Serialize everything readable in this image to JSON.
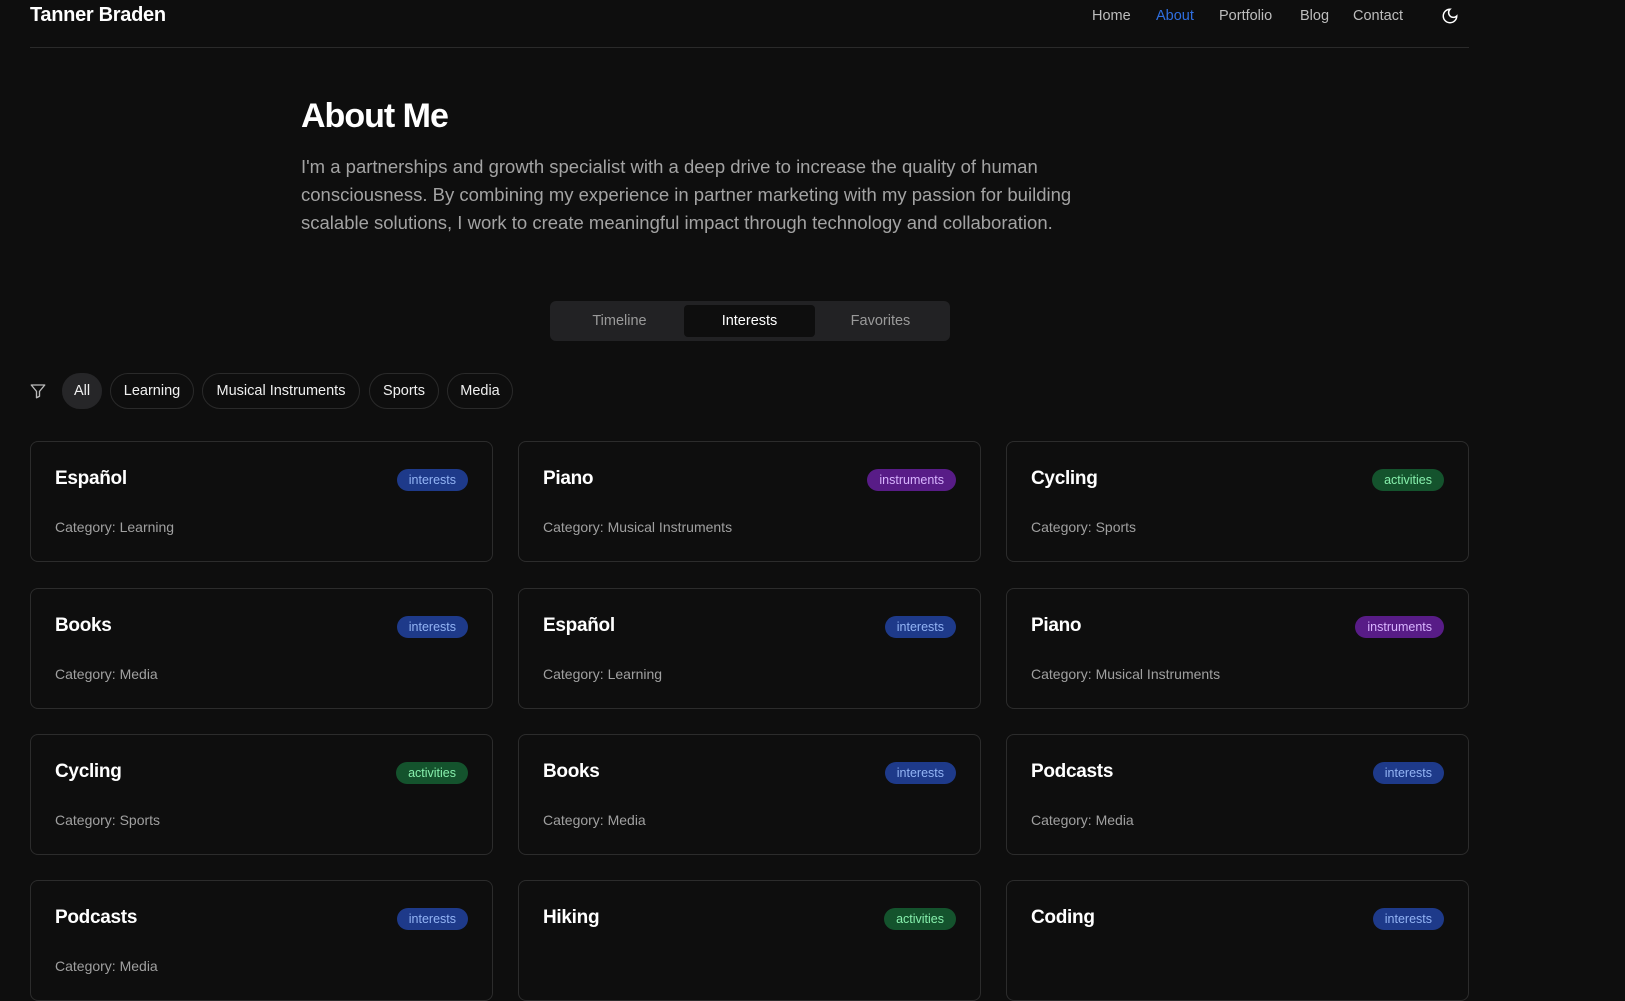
{
  "header": {
    "brand": "Tanner Braden",
    "nav": [
      {
        "label": "Home"
      },
      {
        "label": "About",
        "active": true
      },
      {
        "label": "Portfolio"
      },
      {
        "label": "Blog"
      },
      {
        "label": "Contact"
      }
    ],
    "theme_icon": "moon-icon"
  },
  "about": {
    "title": "About Me",
    "lines": [
      "I'm a partnerships and growth specialist with a deep drive to increase the quality of human",
      "consciousness. By combining my experience in partner marketing with my passion for building",
      "scalable solutions, I work to create meaningful impact through technology and collaboration."
    ]
  },
  "tabs": [
    {
      "label": "Timeline"
    },
    {
      "label": "Interests",
      "active": true
    },
    {
      "label": "Favorites"
    }
  ],
  "filters": [
    {
      "label": "All",
      "active": true
    },
    {
      "label": "Learning"
    },
    {
      "label": "Musical Instruments"
    },
    {
      "label": "Sports"
    },
    {
      "label": "Media"
    }
  ],
  "cards": [
    {
      "title": "Español",
      "badge": "interests",
      "category": "Category: Learning"
    },
    {
      "title": "Piano",
      "badge": "instruments",
      "category": "Category: Musical Instruments"
    },
    {
      "title": "Cycling",
      "badge": "activities",
      "category": "Category: Sports"
    },
    {
      "title": "Books",
      "badge": "interests",
      "category": "Category: Media"
    },
    {
      "title": "Español",
      "badge": "interests",
      "category": "Category: Learning"
    },
    {
      "title": "Piano",
      "badge": "instruments",
      "category": "Category: Musical Instruments"
    },
    {
      "title": "Cycling",
      "badge": "activities",
      "category": "Category: Sports"
    },
    {
      "title": "Books",
      "badge": "interests",
      "category": "Category: Media"
    },
    {
      "title": "Podcasts",
      "badge": "interests",
      "category": "Category: Media"
    },
    {
      "title": "Podcasts",
      "badge": "interests",
      "category": "Category: Media"
    },
    {
      "title": "Hiking",
      "badge": "activities",
      "category": ""
    },
    {
      "title": "Coding",
      "badge": "interests",
      "category": ""
    }
  ],
  "colors": {
    "accent": "#2f6fe0",
    "background": "#0e0e0e"
  }
}
